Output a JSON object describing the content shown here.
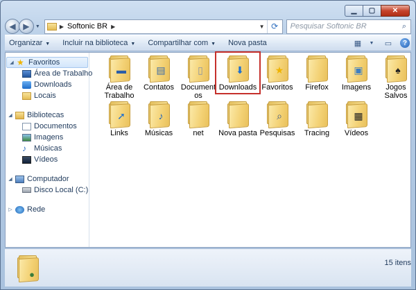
{
  "window": {
    "address": {
      "crumb": "Softonic BR"
    },
    "search": {
      "placeholder": "Pesquisar Softonic BR"
    }
  },
  "toolbar": {
    "organize": "Organizar",
    "include_library": "Incluir na biblioteca",
    "share": "Compartilhar com",
    "new_folder": "Nova pasta"
  },
  "sidebar": {
    "favorites": {
      "header": "Favoritos",
      "items": [
        {
          "label": "Área de Trabalho",
          "icon": "desktop-icon"
        },
        {
          "label": "Downloads",
          "icon": "downloads-icon"
        },
        {
          "label": "Locais",
          "icon": "recent-places-icon"
        }
      ]
    },
    "libraries": {
      "header": "Bibliotecas",
      "items": [
        {
          "label": "Documentos",
          "icon": "documents-icon"
        },
        {
          "label": "Imagens",
          "icon": "pictures-icon"
        },
        {
          "label": "Músicas",
          "icon": "music-icon"
        },
        {
          "label": "Vídeos",
          "icon": "videos-icon"
        }
      ]
    },
    "computer": {
      "header": "Computador",
      "items": [
        {
          "label": "Disco Local (C:)",
          "icon": "drive-icon"
        }
      ]
    },
    "network": {
      "header": "Rede"
    }
  },
  "folders": [
    {
      "label": "Área de Trabalho",
      "icon": "desktop-folder-icon"
    },
    {
      "label": "Contatos",
      "icon": "contacts-folder-icon"
    },
    {
      "label": "Documentos",
      "icon": "documents-folder-icon"
    },
    {
      "label": "Downloads",
      "icon": "downloads-folder-icon"
    },
    {
      "label": "Favoritos",
      "icon": "favorites-folder-icon"
    },
    {
      "label": "Firefox",
      "icon": "folder-icon"
    },
    {
      "label": "Imagens",
      "icon": "pictures-folder-icon"
    },
    {
      "label": "Jogos Salvos",
      "icon": "saved-games-folder-icon"
    },
    {
      "label": "Links",
      "icon": "links-folder-icon"
    },
    {
      "label": "Músicas",
      "icon": "music-folder-icon"
    },
    {
      "label": "net",
      "icon": "folder-icon"
    },
    {
      "label": "Nova pasta",
      "icon": "folder-icon"
    },
    {
      "label": "Pesquisas",
      "icon": "searches-folder-icon"
    },
    {
      "label": "Tracing",
      "icon": "folder-icon"
    },
    {
      "label": "Vídeos",
      "icon": "videos-folder-icon"
    }
  ],
  "status": {
    "count": "15 itens"
  },
  "colors": {
    "highlight": "#c5302b",
    "folder": "#f3d174",
    "accent": "#1e395b"
  }
}
